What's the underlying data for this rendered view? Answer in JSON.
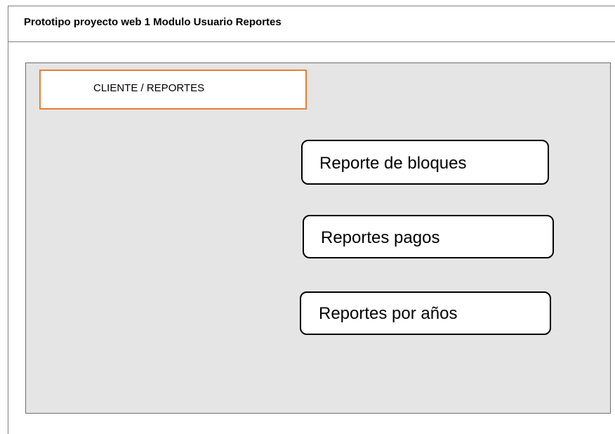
{
  "page": {
    "title": "Prototipo proyecto web 1 Modulo Usuario Reportes"
  },
  "panel": {
    "header": "CLIENTE / REPORTES",
    "buttons": [
      {
        "label": "Reporte de bloques"
      },
      {
        "label": "Reportes pagos"
      },
      {
        "label": "Reportes por años"
      }
    ]
  },
  "colors": {
    "panel_background": "#e5e5e5",
    "header_border": "#ed7d31",
    "button_border": "#000000"
  }
}
